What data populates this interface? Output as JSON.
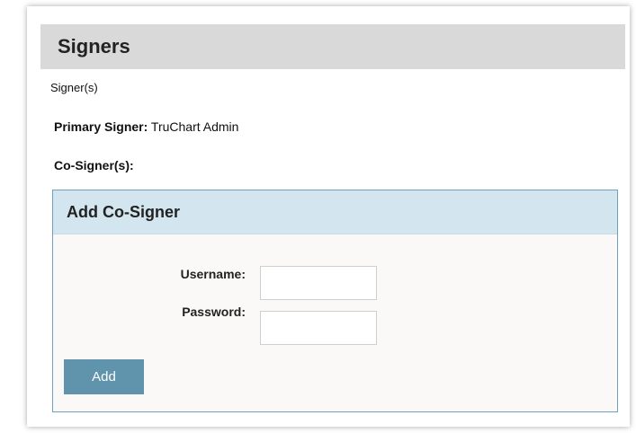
{
  "section": {
    "title": "Signers",
    "sub_label": "Signer(s)"
  },
  "primary_signer": {
    "label": "Primary Signer:",
    "value": "TruChart Admin"
  },
  "cosigners": {
    "label": "Co-Signer(s):"
  },
  "add_panel": {
    "title": "Add Co-Signer",
    "username_label": "Username:",
    "username_value": "",
    "password_label": "Password:",
    "password_value": "",
    "add_label": "Add"
  },
  "colors": {
    "section_header_bg": "#d9d9d9",
    "panel_header_bg": "#d3e5ee",
    "panel_border": "#6fa1bd",
    "button_bg": "#5f94ac"
  }
}
